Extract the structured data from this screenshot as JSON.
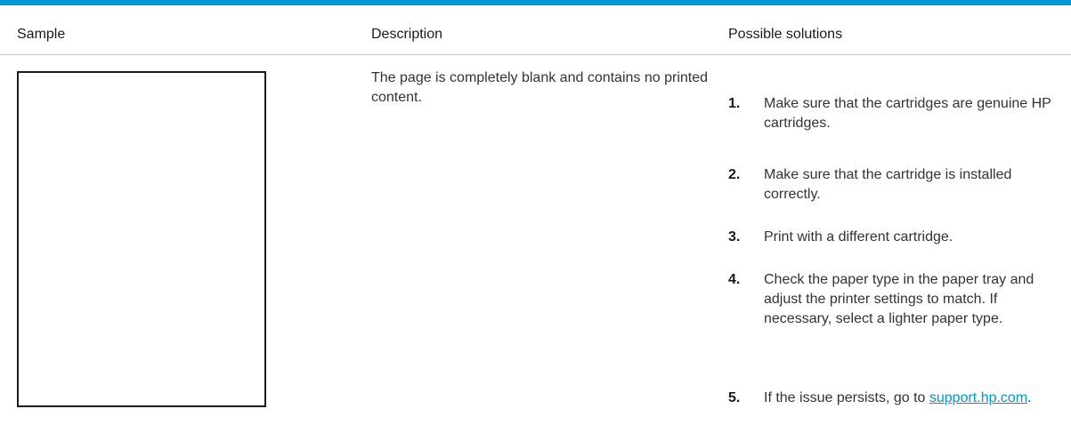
{
  "header": {
    "sample": "Sample",
    "description": "Description",
    "solutions": "Possible solutions"
  },
  "row": {
    "description": "The page is completely blank and contains no printed content.",
    "solutions": [
      {
        "num": "1.",
        "text": "Make sure that the cartridges are genuine HP cartridges."
      },
      {
        "num": "2.",
        "text": "Make sure that the cartridge is installed correctly."
      },
      {
        "num": "3.",
        "text": "Print with a different cartridge."
      },
      {
        "num": "4.",
        "text": "Check the paper type in the paper tray and adjust the printer settings to match. If necessary, select a lighter paper type."
      },
      {
        "num": "5.",
        "text_prefix": "If the issue persists, go to ",
        "link": "support.hp.com",
        "text_suffix": "."
      }
    ]
  },
  "colors": {
    "accent": "#0096d6",
    "rule": "#c8c8c8",
    "text": "#333333"
  }
}
